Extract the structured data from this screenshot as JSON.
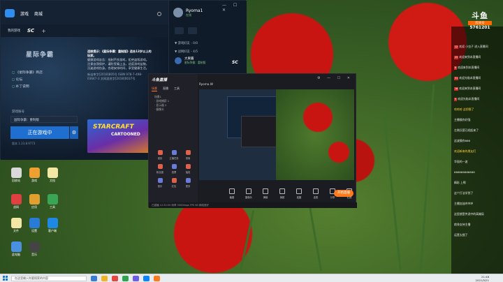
{
  "launcher": {
    "nav": [
      "游戏",
      "商城"
    ],
    "tabs": [
      "我的游戏",
      "SC",
      "+"
    ],
    "game_logo": "星际争霸",
    "links": [
      "《星际争霸》商店",
      "论坛",
      "补丁说明"
    ],
    "server_label": "游戏账号",
    "server_value": "国际争霸：重制版",
    "play_label": "正在游戏中",
    "gear_icon": "gear-icon",
    "version": "版本 1.23.8.9773",
    "notice_head": "适龄提示：《星际争霸：重制版》适合13岁以上的玩家。",
    "notice_body": "健康游戏忠告：抵制不良游戏，拒绝盗版游戏。注意自我保护，谨防受骗上当。适度游戏益脑，沉迷游戏伤身。合理安排时间，享受健康生活。",
    "approval": "新出审字[2018]805号 ISBN 978-7-498-03647-3 文网游进字[2018]0037号",
    "banner_title": "STARCRAFT",
    "banner_sub": "CARTOONED",
    "user": {
      "name": "Ryoma1",
      "status": "在线"
    },
    "groups": [
      {
        "label": "▼ 游戏好友 - 0/0"
      },
      {
        "label": "▼ 战网好友 - 4/5"
      }
    ],
    "friend": {
      "name": "大果酱",
      "status": "星际争霸：重制版"
    },
    "friend_game_badge": "SC"
  },
  "streamer": {
    "logo": "斗鱼直播",
    "tabs": [
      "场景",
      "直播",
      "工具"
    ],
    "scenes": [
      "场景1",
      "· 游戏捕获 1",
      "· 显示器 2",
      "· 摄像头"
    ],
    "room": "Ryoma.W",
    "tools": [
      "截图",
      "摄像头",
      "弹幕",
      "美颜",
      "贴图",
      "连麦",
      "分享",
      "礼物"
    ],
    "grid": [
      "竞猜",
      "主播任务",
      "录像",
      "粉丝团",
      "投票",
      "抽奖",
      "音乐",
      "红包",
      "更多"
    ],
    "go_live": "开始直播",
    "status": "已直播 12:32:55   码率 3000kbps   FPS 60   网络良好"
  },
  "chat": {
    "brand": "斗鱼",
    "room_label": "房间号",
    "room_id": "5761201",
    "lines": [
      {
        "lv": "12",
        "text": "欢迎 小虫子 进入直播间",
        "hl": false
      },
      {
        "lv": "25",
        "text": "欢迎来到本直播间",
        "hl": false
      },
      {
        "lv": "8",
        "text": "欢迎来到本直播间",
        "hl": false
      },
      {
        "lv": "31",
        "text": "欢迎光临本直播间",
        "hl": false
      },
      {
        "lv": "16",
        "text": "欢迎来到本直播间",
        "hl": false
      },
      {
        "lv": "9",
        "text": "欢迎光临本直播间",
        "hl": false
      },
      {
        "lv": "",
        "text": "哈哈哈 这把稳了",
        "hl": true
      },
      {
        "lv": "",
        "text": "主播操作好强",
        "hl": false
      },
      {
        "lv": "",
        "text": "左侧兵营已经起来了",
        "hl": false
      },
      {
        "lv": "",
        "text": "这波操作666",
        "hl": false
      },
      {
        "lv": "",
        "text": "欢迎新来的朋友们",
        "hl": true
      },
      {
        "lv": "",
        "text": "华丽的一波",
        "hl": false
      },
      {
        "lv": "",
        "text": "666666666666",
        "hl": false
      },
      {
        "lv": "",
        "text": "精彩 上啊",
        "hl": false
      },
      {
        "lv": "",
        "text": "这个打法学到了",
        "hl": false
      },
      {
        "lv": "",
        "text": "主播加油冲冲冲",
        "hl": false
      },
      {
        "lv": "",
        "text": "这里就是传说中的高端局",
        "hl": false
      },
      {
        "lv": "",
        "text": "前排支持主播",
        "hl": false
      },
      {
        "lv": "",
        "text": "运营太细了",
        "hl": false
      }
    ]
  },
  "desktop_icons": [
    {
      "label": "回收站",
      "color": "#d9d9d9"
    },
    {
      "label": "游戏",
      "color": "#f0a030"
    },
    {
      "label": "文档",
      "color": "#f3e7a6"
    },
    {
      "label": "战网",
      "color": "#e04040"
    },
    {
      "label": "应用",
      "color": "#e0a030"
    },
    {
      "label": "工具",
      "color": "#3aa655"
    },
    {
      "label": "文件",
      "color": "#f3e7a6"
    },
    {
      "label": "设置",
      "color": "#2a7bd8"
    },
    {
      "label": "客户端",
      "color": "#1e88e5"
    },
    {
      "label": "此电脑",
      "color": "#4a90e2"
    },
    {
      "label": "音乐",
      "color": "#444444"
    }
  ],
  "taskbar": {
    "search_placeholder": "在这里输入你要搜索的内容",
    "time": "21:48",
    "date": "2021/5/21",
    "app_colors": [
      "#3a7bd5",
      "#f0b323",
      "#e8453c",
      "#2ea44f",
      "#6c5ce7",
      "#0a84ff",
      "#ff7a1a"
    ]
  }
}
